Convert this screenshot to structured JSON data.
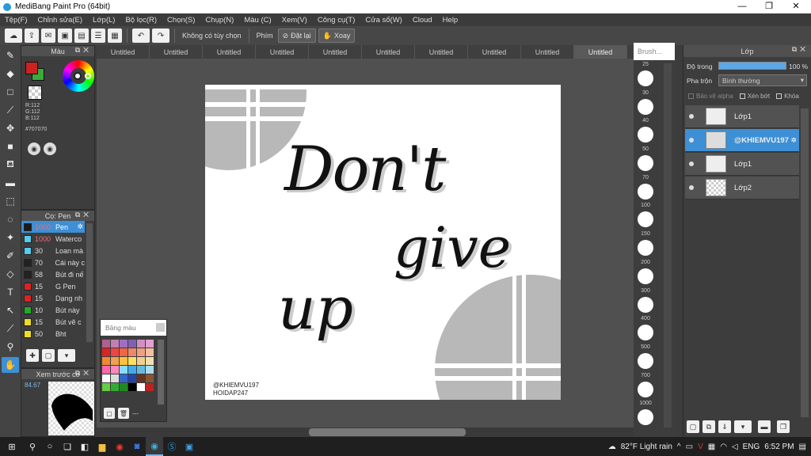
{
  "window": {
    "title": "MediBang Paint Pro (64bit)",
    "controls": [
      "—",
      "❐",
      "✕"
    ]
  },
  "menu": [
    "Tệp(F)",
    "Chỉnh sửa(E)",
    "Lớp(L)",
    "Bộ lọc(R)",
    "Chọn(S)",
    "Chụp(N)",
    "Màu (C)",
    "Xem(V)",
    "Công cụ(T)",
    "Cửa sổ(W)",
    "Cloud",
    "Help"
  ],
  "toolbar": {
    "no_option": "Không có tùy chọn",
    "key_label": "Phím",
    "reset_label": "Đặt lại",
    "rotate_label": "Xoay"
  },
  "color_panel": {
    "title": "Màu",
    "r": "R:112",
    "g": "G:112",
    "b": "B:112",
    "hex": "#707070",
    "fg_color": "#cc2222",
    "bg_color": "#3aaa3a"
  },
  "brush_panel": {
    "title": "Cọ: Pen",
    "items": [
      {
        "size": "1000",
        "name": "Pen",
        "color": "#1a1a1a"
      },
      {
        "size": "1000",
        "name": "Waterco",
        "color": "#55ccee"
      },
      {
        "size": "30",
        "name": "Loan mà",
        "color": "#55ccee"
      },
      {
        "size": "70",
        "name": "Cái này c",
        "color": "#222222"
      },
      {
        "size": "58",
        "name": "Bút đi nế",
        "color": "#222222"
      },
      {
        "size": "15",
        "name": "G Pen",
        "color": "#dd2222"
      },
      {
        "size": "15",
        "name": "Dạng nh",
        "color": "#dd2222"
      },
      {
        "size": "10",
        "name": "Bút này",
        "color": "#22aa22"
      },
      {
        "size": "15",
        "name": "Bút vẽ c",
        "color": "#eedd22"
      },
      {
        "size": "50",
        "name": "Bht",
        "color": "#eedd22"
      }
    ]
  },
  "preview_panel": {
    "title": "Xem trước co",
    "zoom": "84.67"
  },
  "palette": {
    "title": "Bảng màu",
    "footer": "---",
    "colors": [
      "#b06090",
      "#c080b0",
      "#a070c0",
      "#8060b0",
      "#d090c0",
      "#e0a0d0",
      "#dd2222",
      "#ee4444",
      "#ee6644",
      "#ee8866",
      "#f0a080",
      "#f0c0a0",
      "#ee8833",
      "#f0a050",
      "#ffc040",
      "#ffe060",
      "#f0d090",
      "#f0e0b0",
      "#ff66aa",
      "#ff88bb",
      "#88ddff",
      "#44aaee",
      "#66bbdd",
      "#aaddee",
      "#ffffff",
      "#dddddd",
      "#3366cc",
      "#2244aa",
      "#663322",
      "#885533",
      "#66cc44",
      "#33aa33",
      "#228822",
      "#000000",
      "#ffffff",
      "#bb2222"
    ]
  },
  "tabs": [
    "Untitled",
    "Untitled",
    "Untitled",
    "Untitled",
    "Untitled",
    "Untitled",
    "Untitled",
    "Untitled",
    "Untitled",
    "Untitled"
  ],
  "artwork": {
    "line1": "Don't",
    "line2": "give",
    "line3": "up",
    "credit1": "@KHIEMVU197",
    "credit2": "HOIDAP247"
  },
  "brush_sizes": {
    "title": "Brush...",
    "values": [
      "25",
      "30",
      "40",
      "50",
      "70",
      "100",
      "150",
      "200",
      "300",
      "400",
      "500",
      "700",
      "1000"
    ]
  },
  "layer_panel": {
    "title": "Lớp",
    "opacity_label": "Độ trong",
    "opacity_value": "100 %",
    "opacity_fraction": 1.0,
    "blend_label": "Pha trộn",
    "blend_value": "Bình thường",
    "protect_alpha": "Bảo vệ alpha",
    "clipping": "Xén bớt",
    "lock": "Khóa",
    "layers": [
      {
        "name": "Lớp1",
        "selected": false
      },
      {
        "name": "@KHIEMVU197",
        "selected": true
      },
      {
        "name": "Lớp1",
        "selected": false
      },
      {
        "name": "Lớp2",
        "selected": false
      }
    ]
  },
  "taskbar": {
    "weather": "82°F  Light rain",
    "lang": "ENG",
    "time": "6:52 PM"
  }
}
